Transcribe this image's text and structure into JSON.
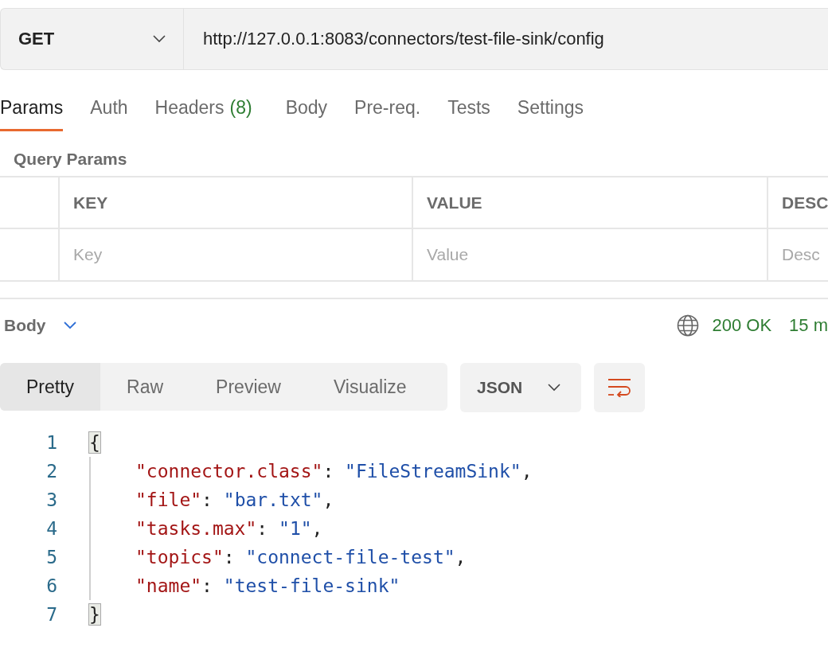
{
  "request": {
    "method": "GET",
    "url": "http://127.0.0.1:8083/connectors/test-file-sink/config"
  },
  "tabs": [
    {
      "label": "Params",
      "selected": true
    },
    {
      "label": "Auth",
      "selected": false
    },
    {
      "label": "Headers",
      "count": "(8)",
      "selected": false
    },
    {
      "label": "Body",
      "selected": false
    },
    {
      "label": "Pre-req.",
      "selected": false
    },
    {
      "label": "Tests",
      "selected": false
    },
    {
      "label": "Settings",
      "selected": false
    }
  ],
  "query_params": {
    "title": "Query Params",
    "columns": [
      "KEY",
      "VALUE",
      "DESC"
    ],
    "placeholders": [
      "Key",
      "Value",
      "Desc"
    ]
  },
  "response": {
    "title": "Body",
    "status": "200 OK",
    "time": "15 m",
    "views": [
      {
        "label": "Pretty",
        "selected": true
      },
      {
        "label": "Raw",
        "selected": false
      },
      {
        "label": "Preview",
        "selected": false
      },
      {
        "label": "Visualize",
        "selected": false
      }
    ],
    "format": "JSON",
    "code": [
      {
        "number": "1",
        "tokens": [
          {
            "kind": "brace",
            "text": "{"
          }
        ]
      },
      {
        "number": "2",
        "tokens": [
          {
            "kind": "key",
            "text": "\"connector.class\""
          },
          {
            "kind": "punct",
            "text": ": "
          },
          {
            "kind": "string",
            "text": "\"FileStreamSink\""
          },
          {
            "kind": "punct",
            "text": ","
          }
        ]
      },
      {
        "number": "3",
        "tokens": [
          {
            "kind": "key",
            "text": "\"file\""
          },
          {
            "kind": "punct",
            "text": ": "
          },
          {
            "kind": "string",
            "text": "\"bar.txt\""
          },
          {
            "kind": "punct",
            "text": ","
          }
        ]
      },
      {
        "number": "4",
        "tokens": [
          {
            "kind": "key",
            "text": "\"tasks.max\""
          },
          {
            "kind": "punct",
            "text": ": "
          },
          {
            "kind": "string",
            "text": "\"1\""
          },
          {
            "kind": "punct",
            "text": ","
          }
        ]
      },
      {
        "number": "5",
        "tokens": [
          {
            "kind": "key",
            "text": "\"topics\""
          },
          {
            "kind": "punct",
            "text": ": "
          },
          {
            "kind": "string",
            "text": "\"connect-file-test\""
          },
          {
            "kind": "punct",
            "text": ","
          }
        ]
      },
      {
        "number": "6",
        "tokens": [
          {
            "kind": "key",
            "text": "\"name\""
          },
          {
            "kind": "punct",
            "text": ": "
          },
          {
            "kind": "string",
            "text": "\"test-file-sink\""
          }
        ]
      },
      {
        "number": "7",
        "tokens": [
          {
            "kind": "brace",
            "text": "}"
          }
        ]
      }
    ]
  }
}
